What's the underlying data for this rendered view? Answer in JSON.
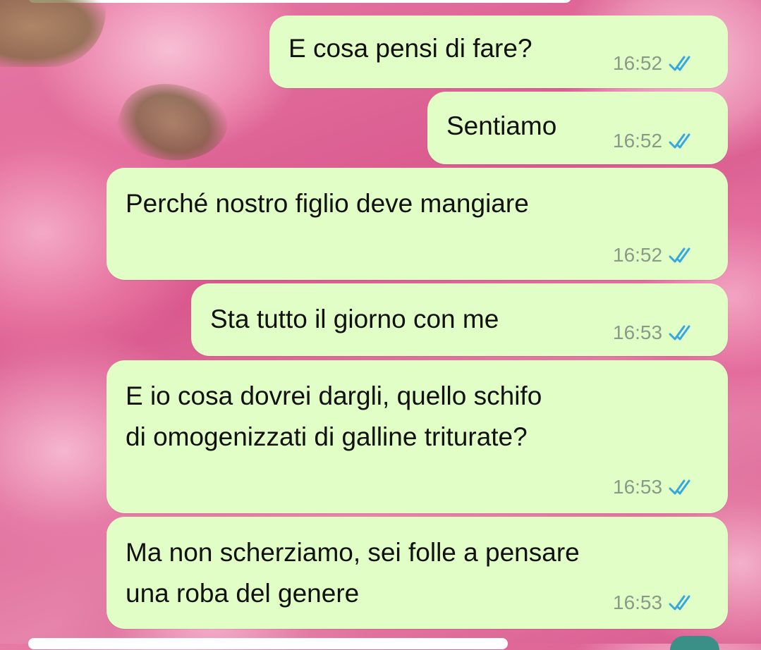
{
  "colors": {
    "bubble": "#e1fec7",
    "timestamp": "#8a9a86",
    "read_check": "#36a8e0"
  },
  "messages": [
    {
      "text": "E cosa pensi di fare?",
      "time": "16:52",
      "status": "read-double-check-icon"
    },
    {
      "text": "Sentiamo",
      "time": "16:52",
      "status": "read-double-check-icon"
    },
    {
      "text": "Perché nostro figlio deve mangiare",
      "time": "16:52",
      "status": "read-double-check-icon"
    },
    {
      "text": "Sta tutto il giorno con me",
      "time": "16:53",
      "status": "read-double-check-icon"
    },
    {
      "lines": [
        "E io cosa dovrei dargli, quello schifo",
        "di omogenizzati di galline triturate?"
      ],
      "time": "16:53",
      "status": "read-double-check-icon"
    },
    {
      "lines": [
        "Ma non scherziamo, sei folle a pensare",
        "una roba del genere"
      ],
      "time": "16:53",
      "status": "read-double-check-icon"
    }
  ]
}
